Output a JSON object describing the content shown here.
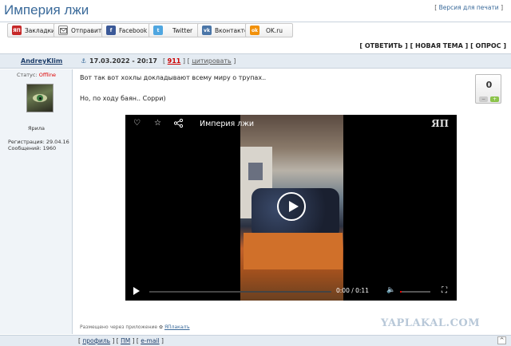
{
  "page": {
    "title": "Империя лжи",
    "print_version": "Версия для печати"
  },
  "share": {
    "bookmarks": "Закладки",
    "send": "Отправить",
    "facebook": "Facebook",
    "twitter": "Twitter",
    "vkontakte": "Вконтакте",
    "okru": "OK.ru",
    "icons": {
      "bookmarks_glyph": "ЯП",
      "vk_glyph": "vk",
      "ok_glyph": "ok"
    },
    "colors": {
      "bookmarks": "#c62828",
      "facebook": "#3b5998",
      "twitter": "#4fa6e0",
      "vkontakte": "#4a76a8",
      "okru": "#f2910a"
    }
  },
  "actions": {
    "reply": "ОТВЕТИТЬ",
    "new_topic": "НОВАЯ ТЕМА",
    "poll": "ОПРОС"
  },
  "post": {
    "author": "AndreyKlim",
    "date": "17.03.2022 - 20:17",
    "number": "911",
    "cite": "цитировать",
    "status_label": "Статус:",
    "status_value": "Offline",
    "rank": "Ярила",
    "registration": "Регистрация: 29.04.16",
    "messages": "Сообщений: 1960",
    "text_line1": "Вот так вот хохлы докладывают всему миру о трупах..",
    "text_line2": "Но, по ходу баян.. Сорри)",
    "rating": "0",
    "placed_via": "Размещено через приложение",
    "app_name": "ЯПлакалъ"
  },
  "video": {
    "title": "Империя лжи",
    "logo": "ЯП",
    "time": "0:00  /  0:11",
    "progress": 0,
    "volume": 0.05
  },
  "footer": {
    "profile": "профиль",
    "pm": "ПМ",
    "email": "e-mail",
    "to_top": "^"
  },
  "watermark": "YAPLAKAL.COM"
}
